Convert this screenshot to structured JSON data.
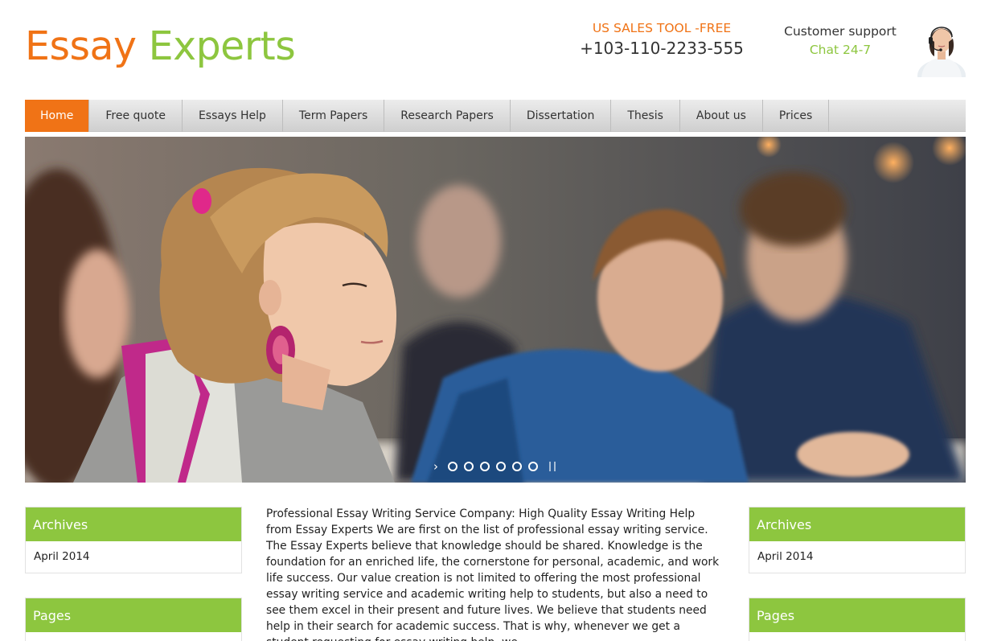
{
  "logo": {
    "word1": "Essay",
    "word2": "Experts"
  },
  "sales": {
    "title": "US SALES TOOL -FREE",
    "phone": "+103-110-2233-555"
  },
  "support": {
    "title": "Customer support",
    "chat": "Chat 24-7"
  },
  "nav": {
    "items": [
      {
        "label": "Home",
        "active": true
      },
      {
        "label": "Free quote"
      },
      {
        "label": "Essays Help"
      },
      {
        "label": "Term Papers"
      },
      {
        "label": "Research Papers"
      },
      {
        "label": "Dissertation"
      },
      {
        "label": "Thesis"
      },
      {
        "label": "About us"
      },
      {
        "label": "Prices"
      }
    ]
  },
  "slider": {
    "arrow_icon": "chevron-right-icon",
    "dot_count": 6,
    "pause_icon": "pause-icon"
  },
  "left_sidebar": {
    "archives": {
      "title": "Archives",
      "items": [
        "April 2014"
      ]
    },
    "pages": {
      "title": "Pages"
    }
  },
  "right_sidebar": {
    "archives": {
      "title": "Archives",
      "items": [
        "April 2014"
      ]
    },
    "pages": {
      "title": "Pages"
    }
  },
  "main": {
    "text": "Professional Essay Writing Service Company: High Quality Essay Writing Help from Essay Experts We are first on the list of professional essay writing service. The Essay Experts believe that knowledge should be shared. Knowledge is the foundation for an enriched life, the cornerstone for personal, academic, and work life success. Our value creation is not limited to offering the most professional essay writing service and academic writing help to students, but also a need to see them excel in their present and future lives. We believe that students need help in their search for academic success. That is why, whenever we get a student requesting for essay writing help, we"
  },
  "colors": {
    "orange": "#f07316",
    "green": "#8dc63f"
  }
}
